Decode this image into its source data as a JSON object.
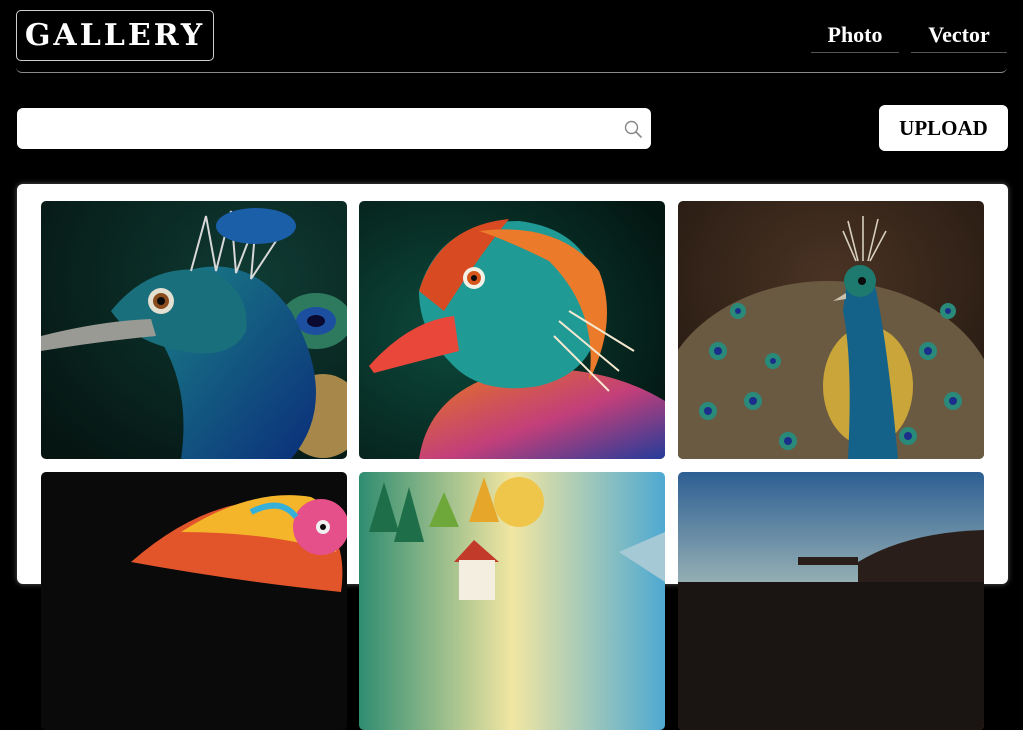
{
  "header": {
    "logo_text": "GALLERY",
    "nav": [
      {
        "label": "Photo"
      },
      {
        "label": "Vector"
      }
    ]
  },
  "search": {
    "placeholder": "",
    "value": "",
    "icon": "search-icon"
  },
  "upload": {
    "label": "UPLOAD"
  },
  "gallery": {
    "images": [
      {
        "name": "peacock-head-closeup"
      },
      {
        "name": "mandarin-duck-portrait"
      },
      {
        "name": "peacock-with-fanned-feathers"
      },
      {
        "name": "colorful-bird-feathers"
      },
      {
        "name": "watercolor-forest-house"
      },
      {
        "name": "sunset-landscape"
      }
    ]
  }
}
